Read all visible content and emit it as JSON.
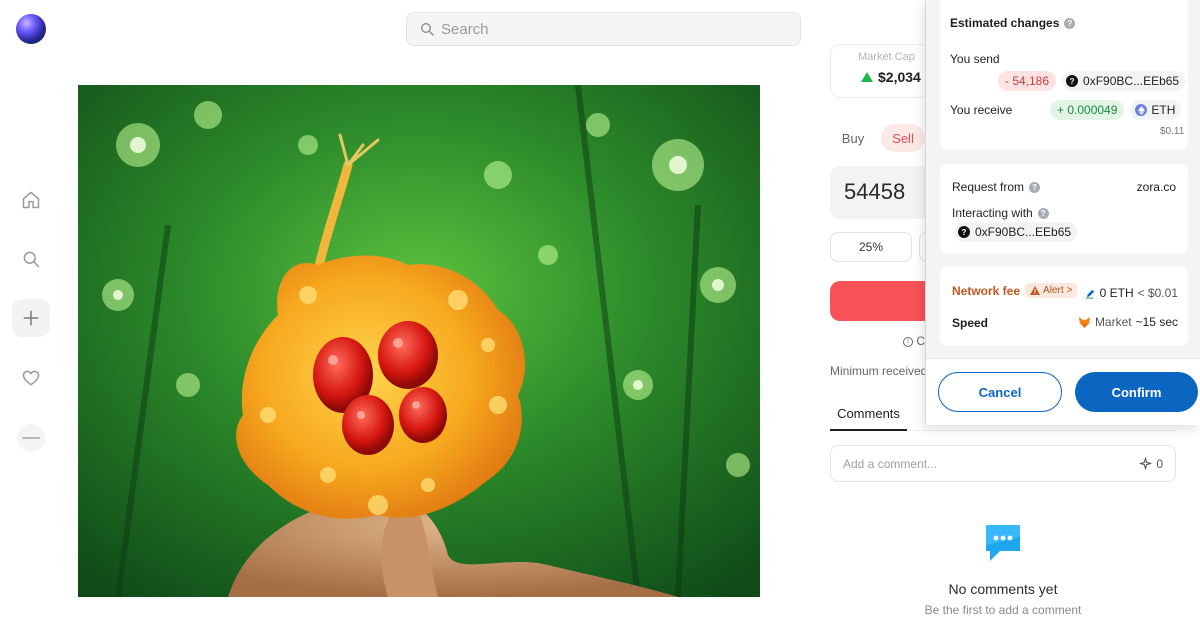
{
  "search": {
    "placeholder": "Search"
  },
  "token": {
    "market_cap_label": "Market Cap",
    "market_cap_value": "$2,034",
    "trade_tabs": {
      "buy": "Buy",
      "sell": "Sell"
    },
    "amount": "54458",
    "quick_amount": "25%",
    "info_stub": "C",
    "minimum_received_label": "Minimum received"
  },
  "comments": {
    "tab_label": "Comments",
    "placeholder": "Add a comment...",
    "spark_count": "0",
    "empty_title": "No comments yet",
    "empty_subtitle": "Be the first to add a comment"
  },
  "wallet": {
    "estimated_changes": "Estimated changes",
    "you_send": "You send",
    "send_amount": "- 54,186",
    "send_address": "0xF90BC...EEb65",
    "you_receive": "You receive",
    "receive_amount": "+ 0.000049",
    "receive_token": "ETH",
    "receive_usd": "$0.11",
    "request_from_label": "Request from",
    "request_from_value": "zora.co",
    "interacting_with_label": "Interacting with",
    "interacting_with_value": "0xF90BC...EEb65",
    "network_fee_label": "Network fee",
    "alert_label": "Alert",
    "fee_eth": "0 ETH",
    "fee_usd": "< $0.01",
    "speed_label": "Speed",
    "speed_value": "Market",
    "speed_time": "~15 sec",
    "cancel": "Cancel",
    "confirm": "Confirm"
  },
  "colors": {
    "sell_red": "#f75257",
    "confirm_blue": "#0b66c2",
    "fee_orange": "#c0561e",
    "positive_green": "#1b8a3b",
    "negative_red": "#c93a3a"
  }
}
